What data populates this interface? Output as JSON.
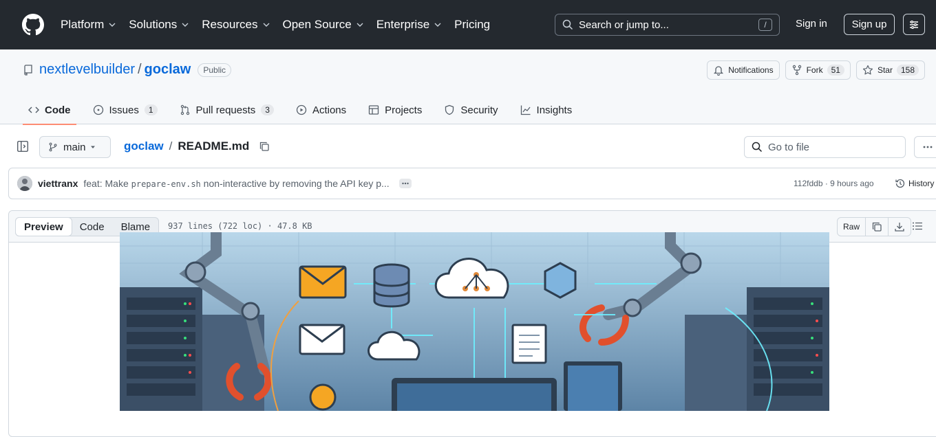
{
  "header": {
    "nav": [
      {
        "label": "Platform",
        "has_menu": true
      },
      {
        "label": "Solutions",
        "has_menu": true
      },
      {
        "label": "Resources",
        "has_menu": true
      },
      {
        "label": "Open Source",
        "has_menu": true
      },
      {
        "label": "Enterprise",
        "has_menu": true
      },
      {
        "label": "Pricing",
        "has_menu": false
      }
    ],
    "search_placeholder": "Search or jump to...",
    "search_shortcut": "/",
    "sign_in": "Sign in",
    "sign_up": "Sign up"
  },
  "repo": {
    "owner": "nextlevelbuilder",
    "separator": "/",
    "name": "goclaw",
    "visibility": "Public",
    "notifications_label": "Notifications",
    "fork_label": "Fork",
    "fork_count": "51",
    "star_label": "Star",
    "star_count": "158",
    "tabs": [
      {
        "label": "Code",
        "icon": "code-icon",
        "count": "",
        "active": true
      },
      {
        "label": "Issues",
        "icon": "issue-icon",
        "count": "1",
        "active": false
      },
      {
        "label": "Pull requests",
        "icon": "pull-request-icon",
        "count": "3",
        "active": false
      },
      {
        "label": "Actions",
        "icon": "play-icon",
        "count": "",
        "active": false
      },
      {
        "label": "Projects",
        "icon": "table-icon",
        "count": "",
        "active": false
      },
      {
        "label": "Security",
        "icon": "shield-icon",
        "count": "",
        "active": false
      },
      {
        "label": "Insights",
        "icon": "graph-icon",
        "count": "",
        "active": false
      }
    ]
  },
  "file_nav": {
    "branch": "main",
    "crumb_repo": "goclaw",
    "crumb_sep": "/",
    "crumb_file": "README.md",
    "goto_placeholder": "Go to file"
  },
  "commit": {
    "author": "viettranx",
    "message_prefix": "feat: Make ",
    "message_code": "prepare-env.sh",
    "message_suffix": " non-interactive by removing the API key p...",
    "sha": "112fddb",
    "time": "9 hours ago",
    "history_label": "History"
  },
  "file_view": {
    "tabs": [
      "Preview",
      "Code",
      "Blame"
    ],
    "active_tab": "Preview",
    "info": "937 lines (722 loc) · 47.8 KB",
    "raw_label": "Raw"
  },
  "colors": {
    "header_bg": "#24292f",
    "link": "#0969da",
    "active_tab_underline": "#fd8c73"
  }
}
